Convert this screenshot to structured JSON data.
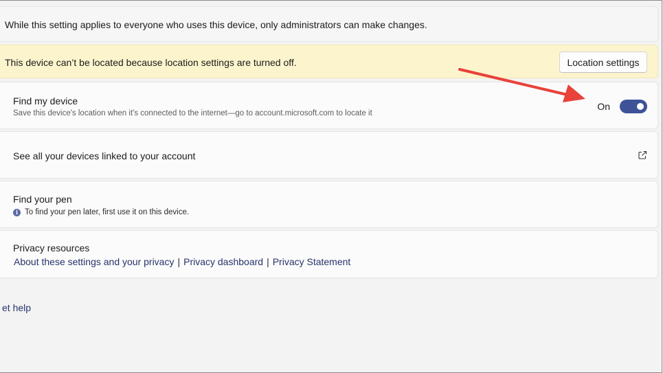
{
  "admin_note": {
    "text": "While this setting applies to everyone who uses this device, only administrators can make changes."
  },
  "location_banner": {
    "text": "This device can’t be located because location settings are turned off.",
    "button_label": "Location settings"
  },
  "find_my_device": {
    "title": "Find my device",
    "description": "Save this device's location when it's connected to the internet—go to account.microsoft.com to locate it",
    "toggle_state_label": "On",
    "toggle_on": true
  },
  "linked_devices": {
    "title": "See all your devices linked to your account",
    "icon": "external-link-icon"
  },
  "find_pen": {
    "title": "Find your pen",
    "info": "To find your pen later, first use it on this device.",
    "icon": "info-icon"
  },
  "privacy": {
    "title": "Privacy resources",
    "links": [
      "About these settings and your privacy",
      "Privacy dashboard",
      "Privacy Statement"
    ],
    "separator": "|"
  },
  "help_link": "et help",
  "colors": {
    "accent": "#3e5297",
    "banner_bg": "#fcf4cc",
    "link": "#27336b",
    "annotation_arrow": "#e8423a"
  }
}
